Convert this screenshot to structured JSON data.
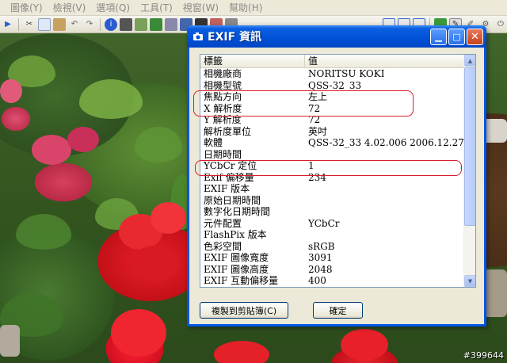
{
  "app": {
    "menu": [
      "圖像(Y)",
      "檢視(V)",
      "選項(Q)",
      "工具(T)",
      "視窗(W)",
      "幫助(H)"
    ]
  },
  "dialog": {
    "title": "EXIF 資訊",
    "columns": {
      "tag": "標籤",
      "value": "值"
    },
    "rows": [
      {
        "tag": "相機廠商",
        "value": "NORITSU KOKI"
      },
      {
        "tag": "相機型號",
        "value": "QSS-32_33"
      },
      {
        "tag": "焦點方向",
        "value": "左上"
      },
      {
        "tag": "X 解析度",
        "value": "72"
      },
      {
        "tag": "Y 解析度",
        "value": "72"
      },
      {
        "tag": "解析度單位",
        "value": "英吋"
      },
      {
        "tag": "軟體",
        "value": "QSS-32_33  4.02.006 2006.12.27"
      },
      {
        "tag": "日期時間",
        "value": ""
      },
      {
        "tag": "YCbCr 定位",
        "value": "1"
      },
      {
        "tag": "Exif 偏移量",
        "value": "234"
      },
      {
        "tag": "EXIF 版本",
        "value": ""
      },
      {
        "tag": "原始日期時間",
        "value": ""
      },
      {
        "tag": "數字化日期時間",
        "value": ""
      },
      {
        "tag": "元件配置",
        "value": "YCbCr"
      },
      {
        "tag": "FlashPix 版本",
        "value": ""
      },
      {
        "tag": "色彩空間",
        "value": "sRGB"
      },
      {
        "tag": "EXIF 圖像寬度",
        "value": "3091"
      },
      {
        "tag": "EXIF 圖像高度",
        "value": "2048"
      },
      {
        "tag": "EXIF 互動偏移量",
        "value": "400"
      }
    ],
    "copy_button": "複製到剪貼簿(C)",
    "ok_button": "確定"
  },
  "watermark": "#399644",
  "colors": {
    "titlebar": "#0054e3",
    "highlight": "#d81e2a"
  }
}
